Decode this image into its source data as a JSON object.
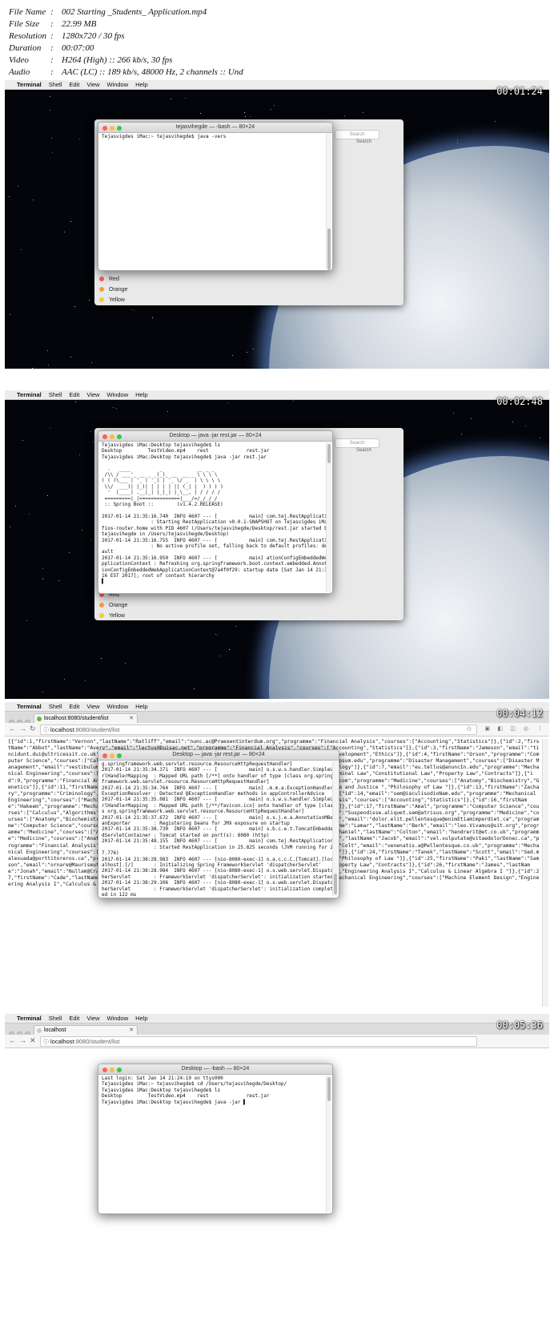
{
  "info": [
    {
      "key": "File Name",
      "value": "002 Starting _Students_ Application.mp4"
    },
    {
      "key": "File Size",
      "value": "22.99 MB"
    },
    {
      "key": "Resolution",
      "value": "1280x720 / 30 fps"
    },
    {
      "key": "Duration",
      "value": "00:07:00"
    },
    {
      "key": "Video",
      "value": "H264 (High) :: 266 kb/s, 30 fps"
    },
    {
      "key": "Audio",
      "value": "AAC (LC) :: 189 kb/s, 48000 Hz, 2 channels :: Und"
    }
  ],
  "menubar": {
    "apple": "",
    "app": "Terminal",
    "items": [
      "Shell",
      "Edit",
      "View",
      "Window",
      "Help"
    ]
  },
  "frames": [
    {
      "timestamp": "00:01:24"
    },
    {
      "timestamp": "00:02:48"
    },
    {
      "timestamp": "00:04:12"
    },
    {
      "timestamp": "00:05:36"
    }
  ],
  "finder": {
    "search_placeholder": "Search",
    "search_label": "Search",
    "tags": [
      {
        "label": "Red",
        "color": "#fc605b"
      },
      {
        "label": "Orange",
        "color": "#fd9a3a"
      },
      {
        "label": "Yellow",
        "color": "#f5cc32"
      }
    ]
  },
  "term1": {
    "title": "tejasvihegde — -bash — 80×24",
    "lines": [
      "Tejasvigdes iMac:~ tejasvihegde$ java -vers"
    ]
  },
  "term2": {
    "title": "Desktop — java -jar rest.jar — 80×24",
    "lines": [
      "Tejasvigdes iMac:Desktop tejasvihegde$ ls",
      "Desktop         TestVideo.mp4    rest             rest.jar",
      "Tejasvigdes iMac:Desktop tejasvihegde$ java -jar rest.jar",
      "",
      "  .   ____          _            __ _ _",
      " /\\\\ / ___'_ __ _ _(_)_ __  __ _ \\ \\ \\ \\",
      "( ( )\\___ | '_ | '_| | '_ \\/ _` | \\ \\ \\ \\",
      " \\\\/  ___)| |_)| | | | | || (_| |  ) ) ) )",
      "  '  |____| .__|_| |_|_| |_\\__, | / / / /",
      " =========|_|==============|___/=/_/_/_/",
      " :: Spring Boot ::        (v1.4.2.RELEASE)",
      "",
      "2017-01-14 21:35:16.740  INFO 4607 --- [           main] com.tej.RestApplication",
      "                 : Starting RestApplication v0.0.1-SNAPSHOT on Tejasvigdes iMac.",
      "fios-router.home with PID 4607 (/Users/tejasvihegde/Desktop/rest.jar started by",
      "tejasvihegde in /Users/tejasvihegde/Desktop)",
      "2017-01-14 21:35:16.755  INFO 4607 --- [           main] com.tej.RestApplication",
      "                 : No active profile set, falling back to default profiles: def",
      "ault",
      "2017-01-14 21:35:16.950  INFO 4607 --- [           main] ationConfigEmbeddedWebA",
      "pplicationContext : Refreshing org.springframework.boot.context.embedded.Annotat",
      "ionConfigEmbeddedWebApplicationContext@7a4f0f29: startup date [Sat Jan 14 21:35:",
      "16 EST 2017]; root of context hierarchy",
      "▌"
    ]
  },
  "browser1": {
    "tab": "localhost:8080/student/list",
    "url_host": "localhost",
    "url_path": ":8080/student/list",
    "json": "[{\"id\":1,\"firstName\":\"Vernon\",\"lastName\":\"Ratliff\",\"email\":\"nunc.ac@Praesentinterdum.org\",\"programme\":\"Financial Analysis\",\"courses\":[\"Accounting\",\"Statistics\"]},{\"id\":2,\"firstName\":\"Abbot\",\"lastName\":\"Avery\",\"email\":\"lectus@Duisac.net\",\"programme\":\"Financial Analysis\",\"courses\":[\"Accounting\",\"Statistics\"]},{\"id\":3,\"firstName\":\"Jameson\",\"email\":\"tincidunt.dui@ultricessit.co.uk\",\"programme\":\"Computer Science\",\"courses\":[\"Calculus\",\"Algorithms\",\"Software Development\",\"Ethics\"]},{\"id\":4,\"firstName\":\"Orson\",\"programme\":\"Computer Science\",\"courses\":[\"Calculus\",\"Algorithms\",\"Software Development\",\"Ethics\"]},{\"id\":5,\"email\":\"mauris@ipsum.edu\",\"programme\":\"Disaster Management\",\"courses\":[\"Disaster Management\",\"email\":\"vestibulum@ridiculusmus.edu\",\"programme\":\"Disaster Management\",\"courses\":[\"Disaster\",\"Geology\"]},{\"id\":7,\"email\":\"eu.tellus@anuncIn.edu\",\"programme\":\"Mechanical Engineering\",\"courses\":[\"Mechanical\"]},{\"id\":8,\"firstName\":\"Jermaine\",\"programme\":\"Law\",\"courses\":[\"Criminal Law\",\"Constitutional Law\",\"Property Law\",\"Contracts\"]},{\"id\":9,\"programme\":\"Financial Analysis\",\"courses\":[\"Accounting\"]},{\"id\":10,\"firstName\":\"Todd\",\"email\":\"magnaet.com\",\"programme\":\"Medicine\",\"courses\":[\"Anatomy\",\"Biochemistry\",\"Genetics\"]},{\"id\":11,\"firstName\":\"Chadwick\",\"programme\":\"Criminology\",\"courses\":[\"Criminal Mind\",\"Gender, Crime and Justice \",\"Philosophy of Law \"]},{\"id\":13,\"firstName\":\"Zachary\",\"programme\":\"Criminology\",\"courses\":[\"Criminal Mind\",\"Gender, Crime and Justice \",\"Philosophy of Law \"]},{\"id\":14,\"email\":\"sem@iaculisodioNam.edu\",\"programme\":\"Mechanical Engineering\",\"courses\":[\"Machine Element Design\"]},{\"id\":15,\"firstName\":\"Hakeem\",\"programme\":\"Financial Analysis\",\"courses\":[\"Accounting\",\"Statistics\"]},{\"id\":16,\"firstName\":\"Hakeem\",\"programme\":\"Mechanical Engineering\",\"courses\":[\"Machine Element Design\",\"Engineering Analysis I\"]},{\"id\":17,\"firstName\":\"Amal\",\"programme\":\"Computer Science\",\"courses\":[\"Calculus\",\"Algorithms\",\"Software Development\"]},{\"id\":18,\"firstName\":\"Reed\",\"lastName\":\"Wylie\",\"email\":\"Suspendisse.aliquet.sem@atrisus.org\",\"programme\":\"Medicine\",\"courses\":[\"Anatomy\",\"Biochemistry\",\"Genetics\",\"Human Behavior.\"]},{\"id\":19,\"firstName\":\"Lev\",\"lastName\":\"Philip\",\"email\":\"dolor.elit.pellentesque@enimEtiamimperdiet.ca\",\"programme\":\"Computer Science\",\"courses\":[\"Calculus\",\"Algorithms\",\"Software Development\",\"Ethics\"]},{\"id\":20,\"firstName\":\"Lamar\",\"lastName\":\"Berk\",\"email\":\"leo.Vivamus@sit.org\",\"programme\":\"Medicine\",\"courses\":[\"Anatomy\",\"Biochemistry\",\"Genetics\",\"Human Behavior.\"]},{\"id\":21,\"firstName\":\"Nathaniel\",\"lastName\":\"Colton\",\"email\":\"hendrerit@et.co.uk\",\"programme\":\"Medicine\",\"courses\":[\"Anatomy\",\"Biochemistry\",\"Genetics\",\"Human Behavior.\"]},{\"id\":22,\"firstName\":\"Kennan\",\"lastName\":\"Jacob\",\"email\":\"vel.vulputate@vitaedolorDonec.ca\",\"programme\":\"Financial Analysis\",\"courses\":[\"Accounting\",\"Statistics\"]},{\"id\":23,\"firstName\":\"Omar\",\"lastName\":\"Colt\",\"email\":\"venenatis.a@Pellentesque.co.uk\",\"programme\":\"Mechanical Engineering\",\"courses\":[\"Machine Element Design\",\"Engineering Analysis I\",\"Calculus & Linear Algebra I \"]},{\"id\":24,\"firstName\":\"Tanek\",\"lastName\":\"Scott\",\"email\":\"Sed.malesuada@porttitoreros.ca\",\"programme\":\"Criminology\",\"courses\":[\"Criminal Mind\",\"Gender, Crime and Justice \",\"Philosophy of Law \"]},{\"id\":25,\"firstName\":\"Paki\",\"lastName\":\"Samson\",\"email\":\"ornare@Mauriseuturpis.edu\",\"programme\":\"Law\",\"courses\":[\"Criminal Law\",\"Constitutional Law\",\"Property Law\",\"Contracts\"]},{\"id\":26,\"firstName\":\"James\",\"lastName\":\"Jonah\",\"email\":\"Nullam@Cras.net\",\"programme\":\"Mechanical Engineering\",\"courses\":[\"Machine Element Design\",\"Engineering Analysis I\",\"Calculus & Linear Algebra I \"]},{\"id\":27,\"firstName\":\"Cade\",\"lastName\":\"Vernon\",\"email\":\"pharetra.sed@Aliquamvulputateullamcorper.ca\",\"programme\":\"Mechanical Engineering\",\"courses\":[\"Machine Element Design\",\"Engineering Analysis I\",\"Calculus & Linear Algebra I \"]},"
  },
  "term3": {
    "title": "Desktop — java -jar rest.jar — 80×24",
    "lines": [
      "g.springframework.web.servlet.resource.ResourceHttpRequestHandler]",
      "2017-01-14 21:35:34.371  INFO 4607 --- [           main] o.s.w.s.handler.SimpleU",
      "rlHandlerMapping  : Mapped URL path [/**] onto handler of type [class org.spring",
      "framework.web.servlet.resource.ResourceHttpRequestHandler]",
      "2017-01-14 21:35:34.764  INFO 4607 --- [           main] .m.m.a.ExceptionHandler",
      "ExceptionResolver : Detected @ExceptionHandler methods in appControllerAdvice",
      "2017-01-14 21:35:35.081  INFO 4607 --- [           main] o.s.w.s.handler.SimpleU",
      "rlHandlerMapping  : Mapped URL path [/**/favicon.ico] onto handler of type [clas",
      "s org.springframework.web.servlet.resource.ResourceHttpRequestHandler]",
      "2017-01-14 21:35:37.672  INFO 4607 --- [           main] o.s.j.e.a.AnnotationMBe",
      "anExporter        : Registering beans for JMX exposure on startup",
      "2017-01-14 21:35:38.730  INFO 4607 --- [           main] s.b.c.e.t.TomcatEmbedde",
      "dServletContainer : Tomcat started on port(s): 8080 (http)",
      "2017-01-14 21:35:48.155  INFO 4607 --- [           main] com.tej.RestApplication",
      "                  : Started RestApplication in 25.825 seconds (JVM running for 2",
      "7.776)",
      "2017-01-14 21:38:28.983  INFO 4607 --- [nio-8080-exec-1] o.a.c.c.C.[Tomcat].[loc",
      "alhost].[/]       : Initializing Spring FrameworkServlet 'dispatcherServlet'",
      "2017-01-14 21:38:28.984  INFO 4607 --- [nio-8080-exec-1] o.s.web.servlet.Dispatc",
      "herServlet        : FrameworkServlet 'dispatcherServlet': initialization started",
      "2017-01-14 21:38:29.106  INFO 4607 --- [nio-8080-exec-1] o.s.web.servlet.Dispatc",
      "herServlet        : FrameworkServlet 'dispatcherServlet': initialization complet",
      "ed in 122 ms",
      "▌"
    ]
  },
  "browser2": {
    "tab": "localhost",
    "url_host": "localhost",
    "url_path": ":8080/student/list"
  },
  "term4": {
    "title": "Desktop — -bash — 80×24",
    "lines": [
      "Last login: Sat Jan 14 21:24:19 on ttys000",
      "Tejasvigdes iMac:~ tejasvihegde$ cd /Users/tejasvihegde/Desktop/",
      "Tejasvigdes iMac:Desktop tejasvihegde$ ls",
      "Desktop         TestVideo.mp4    rest             rest.jar",
      "Tejasvigdes iMac:Desktop tejasvihegde$ java -jar ▌"
    ]
  }
}
